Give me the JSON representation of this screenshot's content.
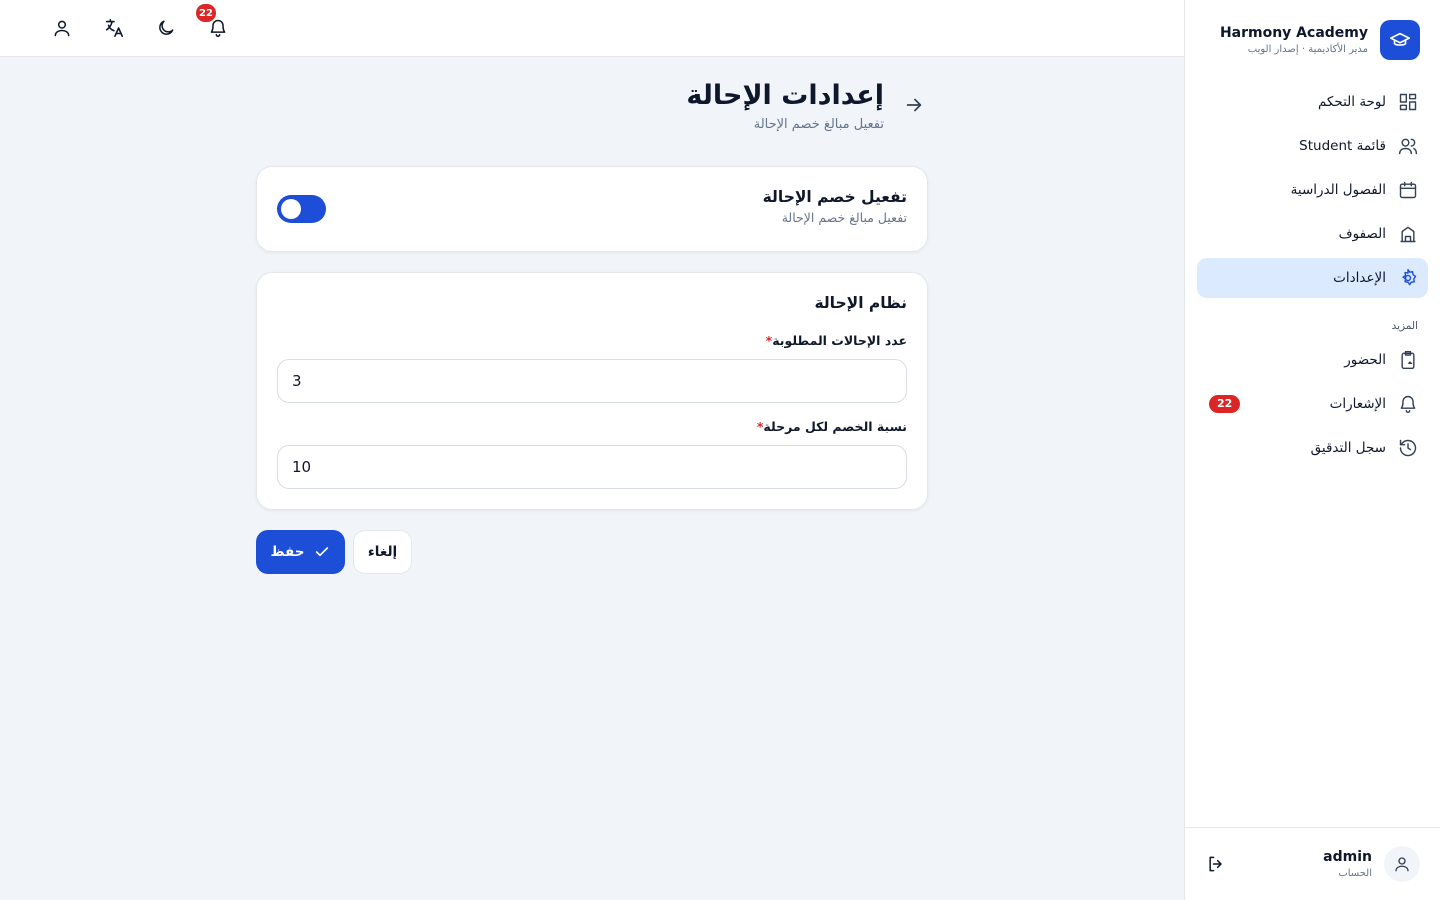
{
  "brand": {
    "name": "Harmony Academy",
    "subtitle": "مدير الأكاديمية · إصدار الويب"
  },
  "nav": {
    "items": [
      {
        "label": "لوحة التحكم",
        "icon": "dashboard-icon"
      },
      {
        "label": "قائمة Student",
        "icon": "users-icon"
      },
      {
        "label": "الفصول الدراسية",
        "icon": "calendar-icon"
      },
      {
        "label": "الصفوف",
        "icon": "building-icon"
      },
      {
        "label": "الإعدادات",
        "icon": "gear-icon",
        "active": true
      }
    ],
    "section_more": "المزيد",
    "more_items": [
      {
        "label": "الحضور",
        "icon": "clipboard-icon"
      },
      {
        "label": "الإشعارات",
        "icon": "bell-icon",
        "badge": "22"
      },
      {
        "label": "سجل التدقيق",
        "icon": "history-icon"
      }
    ]
  },
  "account": {
    "name": "admin",
    "subtitle": "الحساب"
  },
  "topbar": {
    "notification_count": "22"
  },
  "page": {
    "title": "إعدادات الإحالة",
    "subtitle": "تفعيل مبالغ خصم الإحالة"
  },
  "toggle_card": {
    "title": "تفعيل خصم الإحالة",
    "subtitle": "تفعيل مبالغ خصم الإحالة",
    "enabled": true
  },
  "form": {
    "title": "نظام الإحالة",
    "referrals_label": "عدد الإحالات المطلوبة",
    "referrals_value": "3",
    "discount_label": "نسبة الخصم لكل مرحلة",
    "discount_value": "10",
    "required_mark": "*"
  },
  "buttons": {
    "save": "حفظ",
    "cancel": "إلغاء"
  },
  "colors": {
    "accent": "#1d4ed8",
    "active_bg": "#dbeafe",
    "badge": "#dc2626"
  }
}
